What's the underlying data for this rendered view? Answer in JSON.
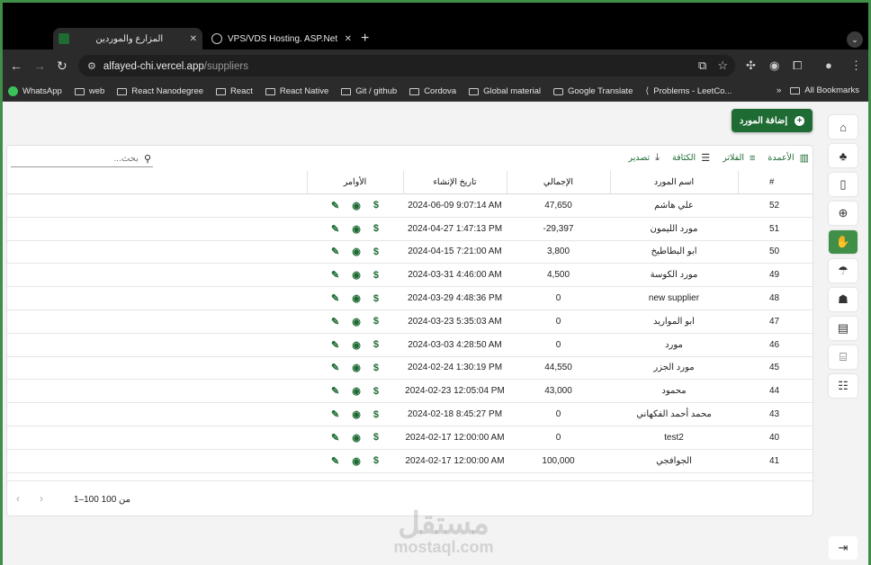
{
  "browser": {
    "tabs": [
      {
        "title": "المزارع والموردين",
        "active": true
      },
      {
        "title": "VPS/VDS Hosting. ASP.Net M",
        "active": false
      }
    ],
    "url_host": "alfayed-chi.vercel.app",
    "url_path": "/suppliers",
    "bookmarks": [
      "WhatsApp",
      "web",
      "React Nanodegree",
      "React",
      "React Native",
      "Git / github",
      "Cordova",
      "Global material",
      "Google Translate",
      "Problems - LeetCo..."
    ],
    "all_bookmarks": "All Bookmarks"
  },
  "page": {
    "add_button": "إضافة المورد",
    "search_placeholder": "بحث...",
    "tools": {
      "columns": "الأعمدة",
      "filters": "الفلاتر",
      "density": "الكثافة",
      "export": "تصدير"
    },
    "headers": {
      "num": "#",
      "name": "اسم المورد",
      "total": "الإجمالي",
      "date": "تاريخ الإنشاء",
      "actions": "الأوامر"
    },
    "rows": [
      {
        "num": "52",
        "name": "علي هاشم",
        "total": "47,650",
        "date": "2024-06-09 9:07:14 AM"
      },
      {
        "num": "51",
        "name": "مورد الليمون",
        "total": "-29,397",
        "date": "2024-04-27 1:47:13 PM"
      },
      {
        "num": "50",
        "name": "ابو البطاطيخ",
        "total": "3,800",
        "date": "2024-04-15 7:21:00 AM"
      },
      {
        "num": "49",
        "name": "مورد الكوسة",
        "total": "4,500",
        "date": "2024-03-31 4:46:00 AM"
      },
      {
        "num": "48",
        "name": "new supplier",
        "total": "0",
        "date": "2024-03-29 4:48:36 PM"
      },
      {
        "num": "47",
        "name": "ابو المواريد",
        "total": "0",
        "date": "2024-03-23 5:35:03 AM"
      },
      {
        "num": "46",
        "name": "مورد",
        "total": "0",
        "date": "2024-03-03 4:28:50 AM"
      },
      {
        "num": "45",
        "name": "مورد الجزر",
        "total": "44,550",
        "date": "2024-02-24 1:30:19 PM"
      },
      {
        "num": "44",
        "name": "محمود",
        "total": "43,000",
        "date": "2024-02-23 12:05:04 PM"
      },
      {
        "num": "43",
        "name": "محمد أحمد الفكهاني",
        "total": "0",
        "date": "2024-02-18 8:45:27 PM"
      },
      {
        "num": "40",
        "name": "test2",
        "total": "0",
        "date": "2024-02-17 12:00:00 AM"
      },
      {
        "num": "41",
        "name": "الجوافجي",
        "total": "100,000",
        "date": "2024-02-17 12:00:00 AM"
      }
    ],
    "pagination": "1–100 من 100",
    "watermark_ar": "مستقل",
    "watermark_en": "mostaql.com"
  },
  "icons": {
    "accent": "#1e6b34",
    "sidebar": [
      "home-icon",
      "tree-icon",
      "building-icon",
      "plus-circle-icon",
      "farmer-icon",
      "watering-icon",
      "user-icon",
      "inbox-icon",
      "bank-icon",
      "group-icon"
    ]
  }
}
